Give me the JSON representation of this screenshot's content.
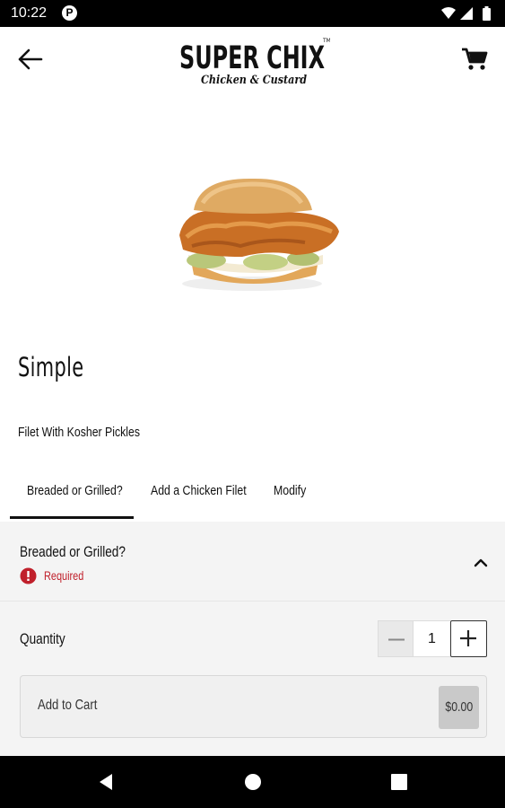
{
  "status_bar": {
    "time": "10:22",
    "app_icon_letter": "P"
  },
  "header": {
    "logo_title": "SUPER CHIX",
    "logo_subtitle": "Chicken & Custard",
    "logo_trademark": "TM",
    "icons": [
      "back-arrow-icon",
      "cart-icon"
    ]
  },
  "product": {
    "image": "chicken-sandwich",
    "name": "Simple",
    "description": "Filet With Kosher Pickles"
  },
  "tabs": [
    {
      "label": "Breaded or Grilled?",
      "active": true
    },
    {
      "label": "Add a Chicken Filet",
      "active": false
    },
    {
      "label": "Modify",
      "active": false
    }
  ],
  "section": {
    "title": "Breaded or Grilled?",
    "required_label": "Required",
    "expanded": true
  },
  "quantity": {
    "label": "Quantity",
    "value": "1"
  },
  "cart": {
    "label": "Add to Cart",
    "price": "$0.00"
  },
  "colors": {
    "required_red": "#c0202b",
    "accent_dark": "#111111",
    "panel_bg": "#f4f4f4"
  }
}
